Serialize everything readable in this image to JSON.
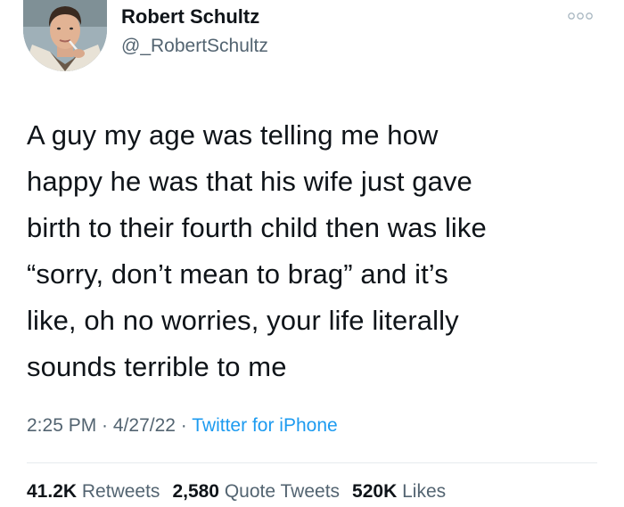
{
  "author": {
    "name": "Robert Schultz",
    "handle": "@_RobertSchultz"
  },
  "menu_icon": "more-horizontal-icon",
  "tweet": {
    "lines": [
      "A guy my age was telling me how",
      "happy he was that his wife just gave",
      "birth to their fourth child then was like",
      "“sorry, don’t mean to brag” and it’s",
      "like, oh no worries, your life literally",
      "sounds terrible to me"
    ]
  },
  "meta": {
    "time": "2:25 PM",
    "sep1": " · ",
    "date": "4/27/22",
    "sep2": " · ",
    "source": "Twitter for iPhone"
  },
  "stats": {
    "retweets_count": "41.2K",
    "retweets_label": "Retweets",
    "quotes_count": "2,580",
    "quotes_label": "Quote Tweets",
    "likes_count": "520K",
    "likes_label": "Likes"
  },
  "colors": {
    "text": "#0f1419",
    "secondary": "#536471",
    "link": "#1d9bf0",
    "divider": "#e6ebee"
  }
}
